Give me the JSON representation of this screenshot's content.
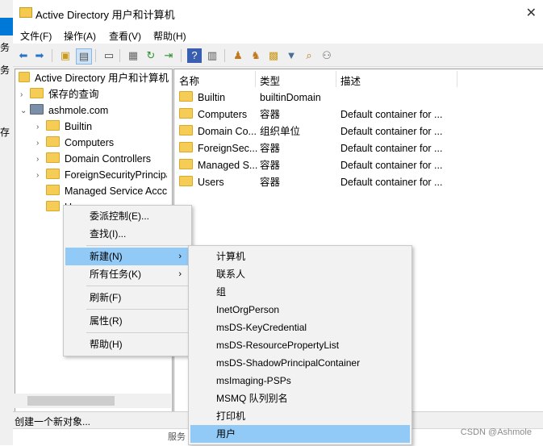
{
  "background": {
    "texts": [
      "务",
      "务",
      "存"
    ]
  },
  "window": {
    "title": "Active Directory 用户和计算机",
    "menu": [
      "文件(F)",
      "操作(A)",
      "查看(V)",
      "帮助(H)"
    ]
  },
  "toolbar": {
    "icons": [
      "back-arrow-icon",
      "forward-arrow-icon",
      "up-folder-icon",
      "tree-view-icon",
      "copy-icon",
      "properties-icon",
      "refresh-icon",
      "export-icon",
      "help-icon",
      "console-icon",
      "add-user-icon",
      "add-group-icon",
      "add-ou-icon",
      "filter-icon",
      "find-icon",
      "add-to-group-icon"
    ]
  },
  "tree": {
    "root": "Active Directory 用户和计算机",
    "saved_queries": "保存的查询",
    "domain": "ashmole.com",
    "children": [
      "Builtin",
      "Computers",
      "Domain Controllers",
      "ForeignSecurityPrincipa",
      "Managed Service Accc",
      "Users"
    ]
  },
  "list": {
    "headers": [
      "名称",
      "类型",
      "描述"
    ],
    "rows": [
      {
        "name": "Builtin",
        "type": "builtinDomain",
        "desc": ""
      },
      {
        "name": "Computers",
        "type": "容器",
        "desc": "Default container for ..."
      },
      {
        "name": "Domain Co...",
        "type": "组织单位",
        "desc": "Default container for ..."
      },
      {
        "name": "ForeignSec...",
        "type": "容器",
        "desc": "Default container for ..."
      },
      {
        "name": "Managed S...",
        "type": "容器",
        "desc": "Default container for ..."
      },
      {
        "name": "Users",
        "type": "容器",
        "desc": "Default container for ..."
      }
    ]
  },
  "context_menu": {
    "items": [
      "委派控制(E)...",
      "查找(I)...",
      "新建(N)",
      "所有任务(K)",
      "刷新(F)",
      "属性(R)",
      "帮助(H)"
    ],
    "highlighted": "新建(N)"
  },
  "submenu": {
    "items": [
      "计算机",
      "联系人",
      "组",
      "InetOrgPerson",
      "msDS-KeyCredential",
      "msDS-ResourcePropertyList",
      "msDS-ShadowPrincipalContainer",
      "msImaging-PSPs",
      "MSMQ 队列别名",
      "打印机",
      "用户"
    ],
    "highlighted": "用户"
  },
  "status": "创建一个新对象...",
  "behind_text": "服务",
  "watermark": "CSDN @Ashmole",
  "colors": {
    "highlight": "#91c9f7",
    "accent": "#0078d7",
    "folder": "#f5cc55"
  }
}
